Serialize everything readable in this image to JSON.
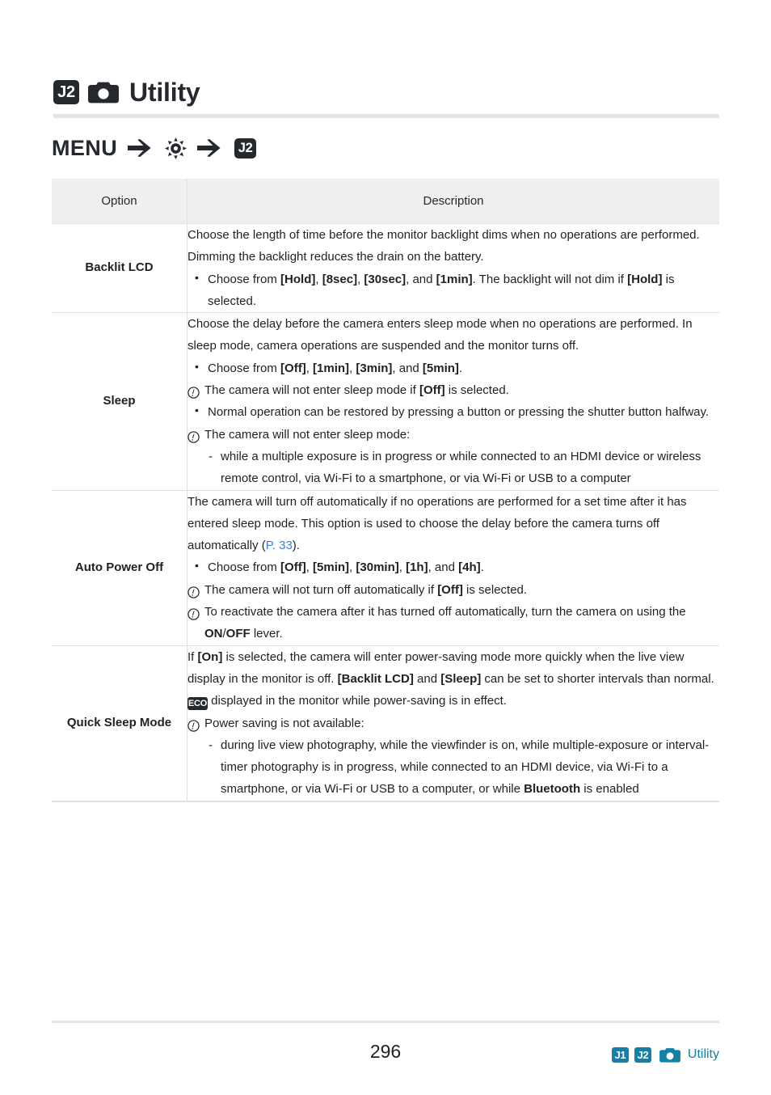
{
  "header": {
    "badge": "J2",
    "camera_icon": "camera-icon",
    "title": "Utility"
  },
  "breadcrumb": {
    "menu_label": "MENU",
    "arrow_icon": "arrow-right-icon",
    "setup_icon": "gear-icon",
    "target_badge": "J2"
  },
  "table": {
    "headers": {
      "option": "Option",
      "description": "Description"
    },
    "rows": [
      {
        "option": "Backlit LCD",
        "intro": "Choose the length of time before the monitor backlight dims when no operations are performed. Dimming the backlight reduces the drain on the battery.",
        "bullets": [
          {
            "type": "bullet",
            "parts": [
              {
                "t": "Choose from "
              },
              {
                "t": "[Hold]",
                "b": true
              },
              {
                "t": ", "
              },
              {
                "t": "[8sec]",
                "b": true
              },
              {
                "t": ", "
              },
              {
                "t": "[30sec]",
                "b": true
              },
              {
                "t": ", and "
              },
              {
                "t": "[1min]",
                "b": true
              },
              {
                "t": ". The backlight will not dim if "
              },
              {
                "t": "[Hold]",
                "b": true
              },
              {
                "t": " is selected."
              }
            ]
          }
        ]
      },
      {
        "option": "Sleep",
        "intro": "Choose the delay before the camera enters sleep mode when no operations are performed. In sleep mode, camera operations are suspended and the monitor turns off.",
        "bullets": [
          {
            "type": "bullet",
            "parts": [
              {
                "t": "Choose from "
              },
              {
                "t": "[Off]",
                "b": true
              },
              {
                "t": ", "
              },
              {
                "t": "[1min]",
                "b": true
              },
              {
                "t": ", "
              },
              {
                "t": "[3min]",
                "b": true
              },
              {
                "t": ", and "
              },
              {
                "t": "[5min]",
                "b": true
              },
              {
                "t": "."
              }
            ]
          },
          {
            "type": "note",
            "parts": [
              {
                "t": "The camera will not enter sleep mode if "
              },
              {
                "t": "[Off]",
                "b": true
              },
              {
                "t": " is selected."
              }
            ]
          },
          {
            "type": "bullet",
            "parts": [
              {
                "t": "Normal operation can be restored by pressing a button or pressing the shutter button halfway."
              }
            ]
          },
          {
            "type": "note",
            "parts": [
              {
                "t": "The camera will not enter sleep mode:"
              }
            ],
            "sub": [
              "while a multiple exposure is in progress or while connected to an HDMI device or wireless remote control, via Wi-Fi to a smartphone, or via Wi-Fi or USB to a computer"
            ]
          }
        ]
      },
      {
        "option": "Auto Power Off",
        "intro_parts": [
          {
            "t": "The camera will turn off automatically if no operations are performed for a set time after it has entered sleep mode. This option is used to choose the delay before the camera turns off automatically ("
          },
          {
            "t": "P. 33",
            "link": true
          },
          {
            "t": ")."
          }
        ],
        "bullets": [
          {
            "type": "bullet",
            "parts": [
              {
                "t": "Choose from "
              },
              {
                "t": "[Off]",
                "b": true
              },
              {
                "t": ", "
              },
              {
                "t": "[5min]",
                "b": true
              },
              {
                "t": ", "
              },
              {
                "t": "[30min]",
                "b": true
              },
              {
                "t": ", "
              },
              {
                "t": "[1h]",
                "b": true
              },
              {
                "t": ", and "
              },
              {
                "t": "[4h]",
                "b": true
              },
              {
                "t": "."
              }
            ]
          },
          {
            "type": "note",
            "parts": [
              {
                "t": "The camera will not turn off automatically if "
              },
              {
                "t": "[Off]",
                "b": true
              },
              {
                "t": " is selected."
              }
            ]
          },
          {
            "type": "note",
            "parts": [
              {
                "t": "To reactivate the camera after it has turned off automatically, turn the camera on using the "
              },
              {
                "t": "ON",
                "b": true
              },
              {
                "t": "/"
              },
              {
                "t": "OFF",
                "b": true
              },
              {
                "t": " lever."
              }
            ]
          }
        ]
      },
      {
        "option": "Quick Sleep Mode",
        "intro_parts": [
          {
            "t": "If "
          },
          {
            "t": "[On]",
            "b": true
          },
          {
            "t": " is selected, the camera will enter power-saving mode more quickly when the live view display in the monitor is off. "
          },
          {
            "t": "[Backlit LCD]",
            "b": true
          },
          {
            "t": " and "
          },
          {
            "t": "[Sleep]",
            "b": true
          },
          {
            "t": " can be set to shorter intervals than normal. "
          },
          {
            "t": "ECO",
            "eco": true
          },
          {
            "t": " displayed in the monitor while power-saving is in effect."
          }
        ],
        "bullets": [
          {
            "type": "note",
            "parts": [
              {
                "t": "Power saving is not available:"
              }
            ],
            "sub_parts": [
              [
                {
                  "t": "during live view photography, while the viewfinder is on, while multiple-exposure or interval-timer photography is in progress, while connected to an HDMI device, via Wi-Fi to a smartphone, or via Wi-Fi or USB to a computer, or while "
                },
                {
                  "t": "Bluetooth",
                  "b": true
                },
                {
                  "t": " is enabled"
                }
              ]
            ]
          }
        ]
      }
    ]
  },
  "footer": {
    "page_number": "296",
    "badges": [
      "J1",
      "J2"
    ],
    "camera_icon": "camera-icon",
    "label": "Utility"
  },
  "colors": {
    "dark": "#25292e",
    "teal": "#1380a8",
    "link_blue": "#3b7de0",
    "rule_gray": "#e2e4e6",
    "header_bg": "#efeff0"
  }
}
